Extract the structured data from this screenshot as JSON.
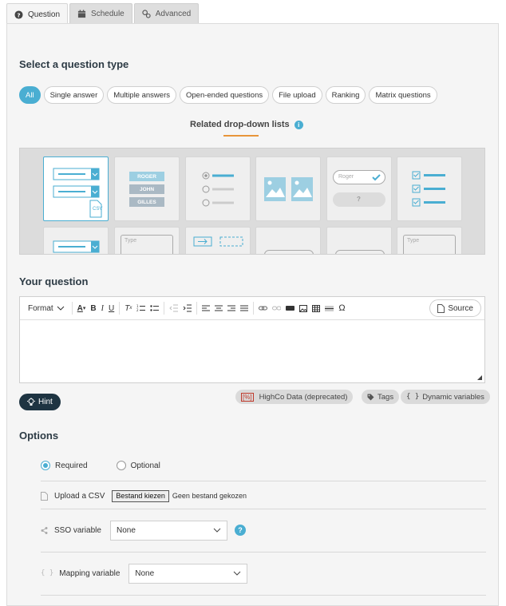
{
  "tabs": [
    {
      "label": "Question",
      "icon": "question-circle-icon",
      "active": true
    },
    {
      "label": "Schedule",
      "icon": "calendar-icon",
      "active": false
    },
    {
      "label": "Advanced",
      "icon": "gears-icon",
      "active": false
    }
  ],
  "select_type": {
    "title": "Select a question type",
    "filters": [
      "All",
      "Single answer",
      "Multiple answers",
      "Open-ended questions",
      "File upload",
      "Ranking",
      "Matrix questions"
    ],
    "active_filter": "All",
    "related_label": "Related drop-down lists",
    "card_texts": {
      "names": [
        "ROGER",
        "JOHN",
        "GILLES"
      ],
      "roger": "Roger",
      "question_mark": "?",
      "csv": "CSV",
      "type": "Type"
    }
  },
  "your_question": {
    "title": "Your question",
    "format_label": "Format",
    "source_label": "Source",
    "hint_label": "Hint",
    "tags": {
      "highco": "HighCo Data (deprecated)",
      "tags": "Tags",
      "dynamic": "Dynamic variables",
      "braces": "{ }",
      "percent": "[%]"
    }
  },
  "options": {
    "title": "Options",
    "required_label": "Required",
    "optional_label": "Optional",
    "required_selected": true,
    "upload_csv_label": "Upload a CSV",
    "file_button_label": "Bestand kiezen",
    "file_status": "Geen bestand gekozen",
    "sso_label": "SSO variable",
    "sso_value": "None",
    "mapping_label": "Mapping variable",
    "mapping_value": "None"
  },
  "colors": {
    "accent": "#4aaed2",
    "dark": "#1e3442",
    "underline": "#e8953a"
  }
}
